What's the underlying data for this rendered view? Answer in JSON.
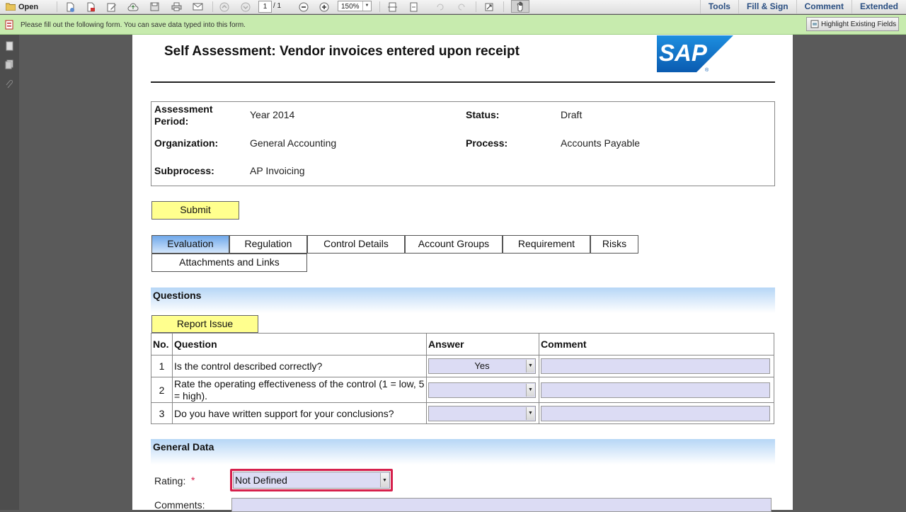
{
  "toolbar": {
    "open_label": "Open",
    "page_current": "1",
    "page_total": "/ 1",
    "zoom": "150%",
    "links": [
      "Tools",
      "Fill & Sign",
      "Comment",
      "Extended"
    ]
  },
  "notification": {
    "text": "Please fill out the following form. You can save data typed into this form.",
    "highlight_button": "Highlight Existing Fields"
  },
  "document": {
    "title": "Self Assessment: Vendor invoices entered upon receipt",
    "logo_text": "SAP",
    "info": {
      "period_label_1": "Assessment",
      "period_label_2": "Period:",
      "period_value": "Year 2014",
      "status_label": "Status:",
      "status_value": "Draft",
      "organization_label": "Organization:",
      "organization_value": "General Accounting",
      "process_label": "Process:",
      "process_value": "Accounts Payable",
      "subprocess_label": "Subprocess:",
      "subprocess_value": "AP Invoicing"
    },
    "submit_label": "Submit",
    "tabs": [
      "Evaluation",
      "Regulation",
      "Control Details",
      "Account Groups",
      "Requirement",
      "Risks",
      "Attachments and Links"
    ],
    "active_tab": "Evaluation",
    "questions_header": "Questions",
    "report_issue_label": "Report Issue",
    "table": {
      "headers": [
        "No.",
        "Question",
        "Answer",
        "Comment"
      ],
      "rows": [
        {
          "no": "1",
          "question": "Is the control described correctly?",
          "answer": "Yes"
        },
        {
          "no": "2",
          "question": "Rate the operating effectiveness of the control (1 = low, 5 = high).",
          "answer": ""
        },
        {
          "no": "3",
          "question": "Do you have written support for your conclusions?",
          "answer": ""
        }
      ]
    },
    "general_header": "General Data",
    "rating_label": "Rating:",
    "required_mark": "*",
    "rating_value": "Not Defined",
    "comments_label": "Comments:"
  },
  "colors": {
    "accent_red": "#d6204c",
    "field_bg": "#dcdcf4",
    "button_yellow": "#ffff8e",
    "tab_active": "#6fa8ea",
    "notify_green": "#c7ebae"
  }
}
